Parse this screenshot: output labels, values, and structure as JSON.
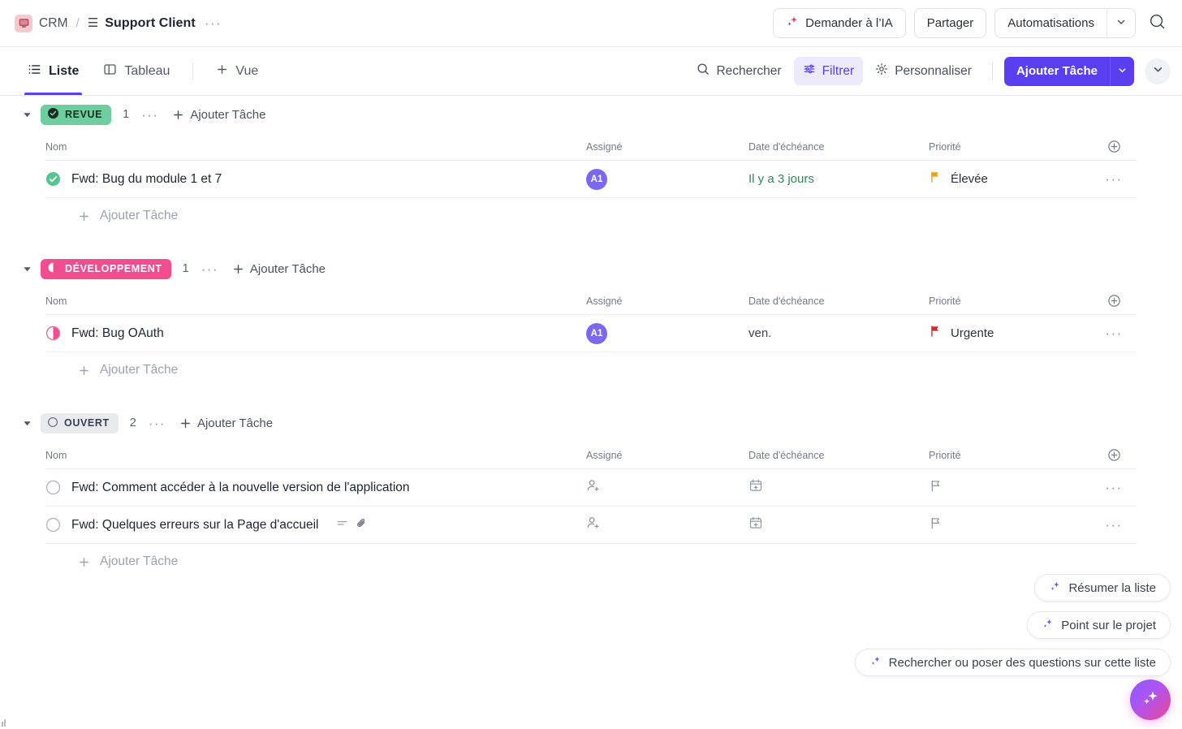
{
  "header": {
    "workspace": "CRM",
    "separator": "/",
    "title": "Support Client",
    "more": "···",
    "ask_ai": "Demander à l’IA",
    "share": "Partager",
    "automations": "Automatisations"
  },
  "toolbar": {
    "tabs": [
      {
        "label": "Liste",
        "icon": "list-icon",
        "active": true
      },
      {
        "label": "Tableau",
        "icon": "board-icon",
        "active": false
      }
    ],
    "add_view": "Vue",
    "search": "Rechercher",
    "filter": "Filtrer",
    "customize": "Personnaliser",
    "add_task": "Ajouter Tâche"
  },
  "columns": {
    "name": "Nom",
    "assignee": "Assigné",
    "due": "Date d'échéance",
    "priority": "Priorité"
  },
  "common": {
    "add_task": "Ajouter Tâche",
    "dots": "···"
  },
  "groups": [
    {
      "status": "REVUE",
      "status_key": "revue",
      "count": "1",
      "badge_color": "#6fce9f",
      "tasks": [
        {
          "title": "Fwd: Bug du module 1 et 7",
          "status_icon": "check-circle-filled-icon",
          "assignee": "A1",
          "assignee_color": "#7b68ee",
          "due": "Il y a 3 jours",
          "due_state": "overdue",
          "priority": "Élevée",
          "priority_color": "#e8a317",
          "has_description": false,
          "has_attachment": false
        }
      ]
    },
    {
      "status": "DÉVELOPPEMENT",
      "status_key": "dev",
      "count": "1",
      "badge_color": "#f24d8f",
      "tasks": [
        {
          "title": "Fwd: Bug OAuth",
          "status_icon": "half-circle-icon",
          "assignee": "A1",
          "assignee_color": "#7b68ee",
          "due": "ven.",
          "due_state": "normal",
          "priority": "Urgente",
          "priority_color": "#cf2a2a",
          "has_description": false,
          "has_attachment": false
        }
      ]
    },
    {
      "status": "OUVERT",
      "status_key": "open",
      "count": "2",
      "badge_color": "#e9eaee",
      "tasks": [
        {
          "title": "Fwd: Comment accéder à la nouvelle version de l'application",
          "status_icon": "empty-circle-icon",
          "assignee": "",
          "assignee_color": "",
          "due": "",
          "due_state": "empty",
          "priority": "",
          "priority_color": "",
          "has_description": false,
          "has_attachment": false
        },
        {
          "title": "Fwd: Quelques erreurs sur la Page d'accueil",
          "status_icon": "empty-circle-icon",
          "assignee": "",
          "assignee_color": "",
          "due": "",
          "due_state": "empty",
          "priority": "",
          "priority_color": "",
          "has_description": true,
          "has_attachment": true
        }
      ]
    }
  ],
  "ai": {
    "summarize": "Résumer la liste",
    "project_update": "Point sur le projet",
    "ask": "Rechercher ou poser des questions sur cette liste"
  },
  "colors": {
    "accent": "#5a3ff0",
    "filter_bg": "#eeeafd",
    "overdue": "#2e8b57",
    "urgent_flag": "#cf2a2a",
    "high_flag": "#e8a317"
  }
}
